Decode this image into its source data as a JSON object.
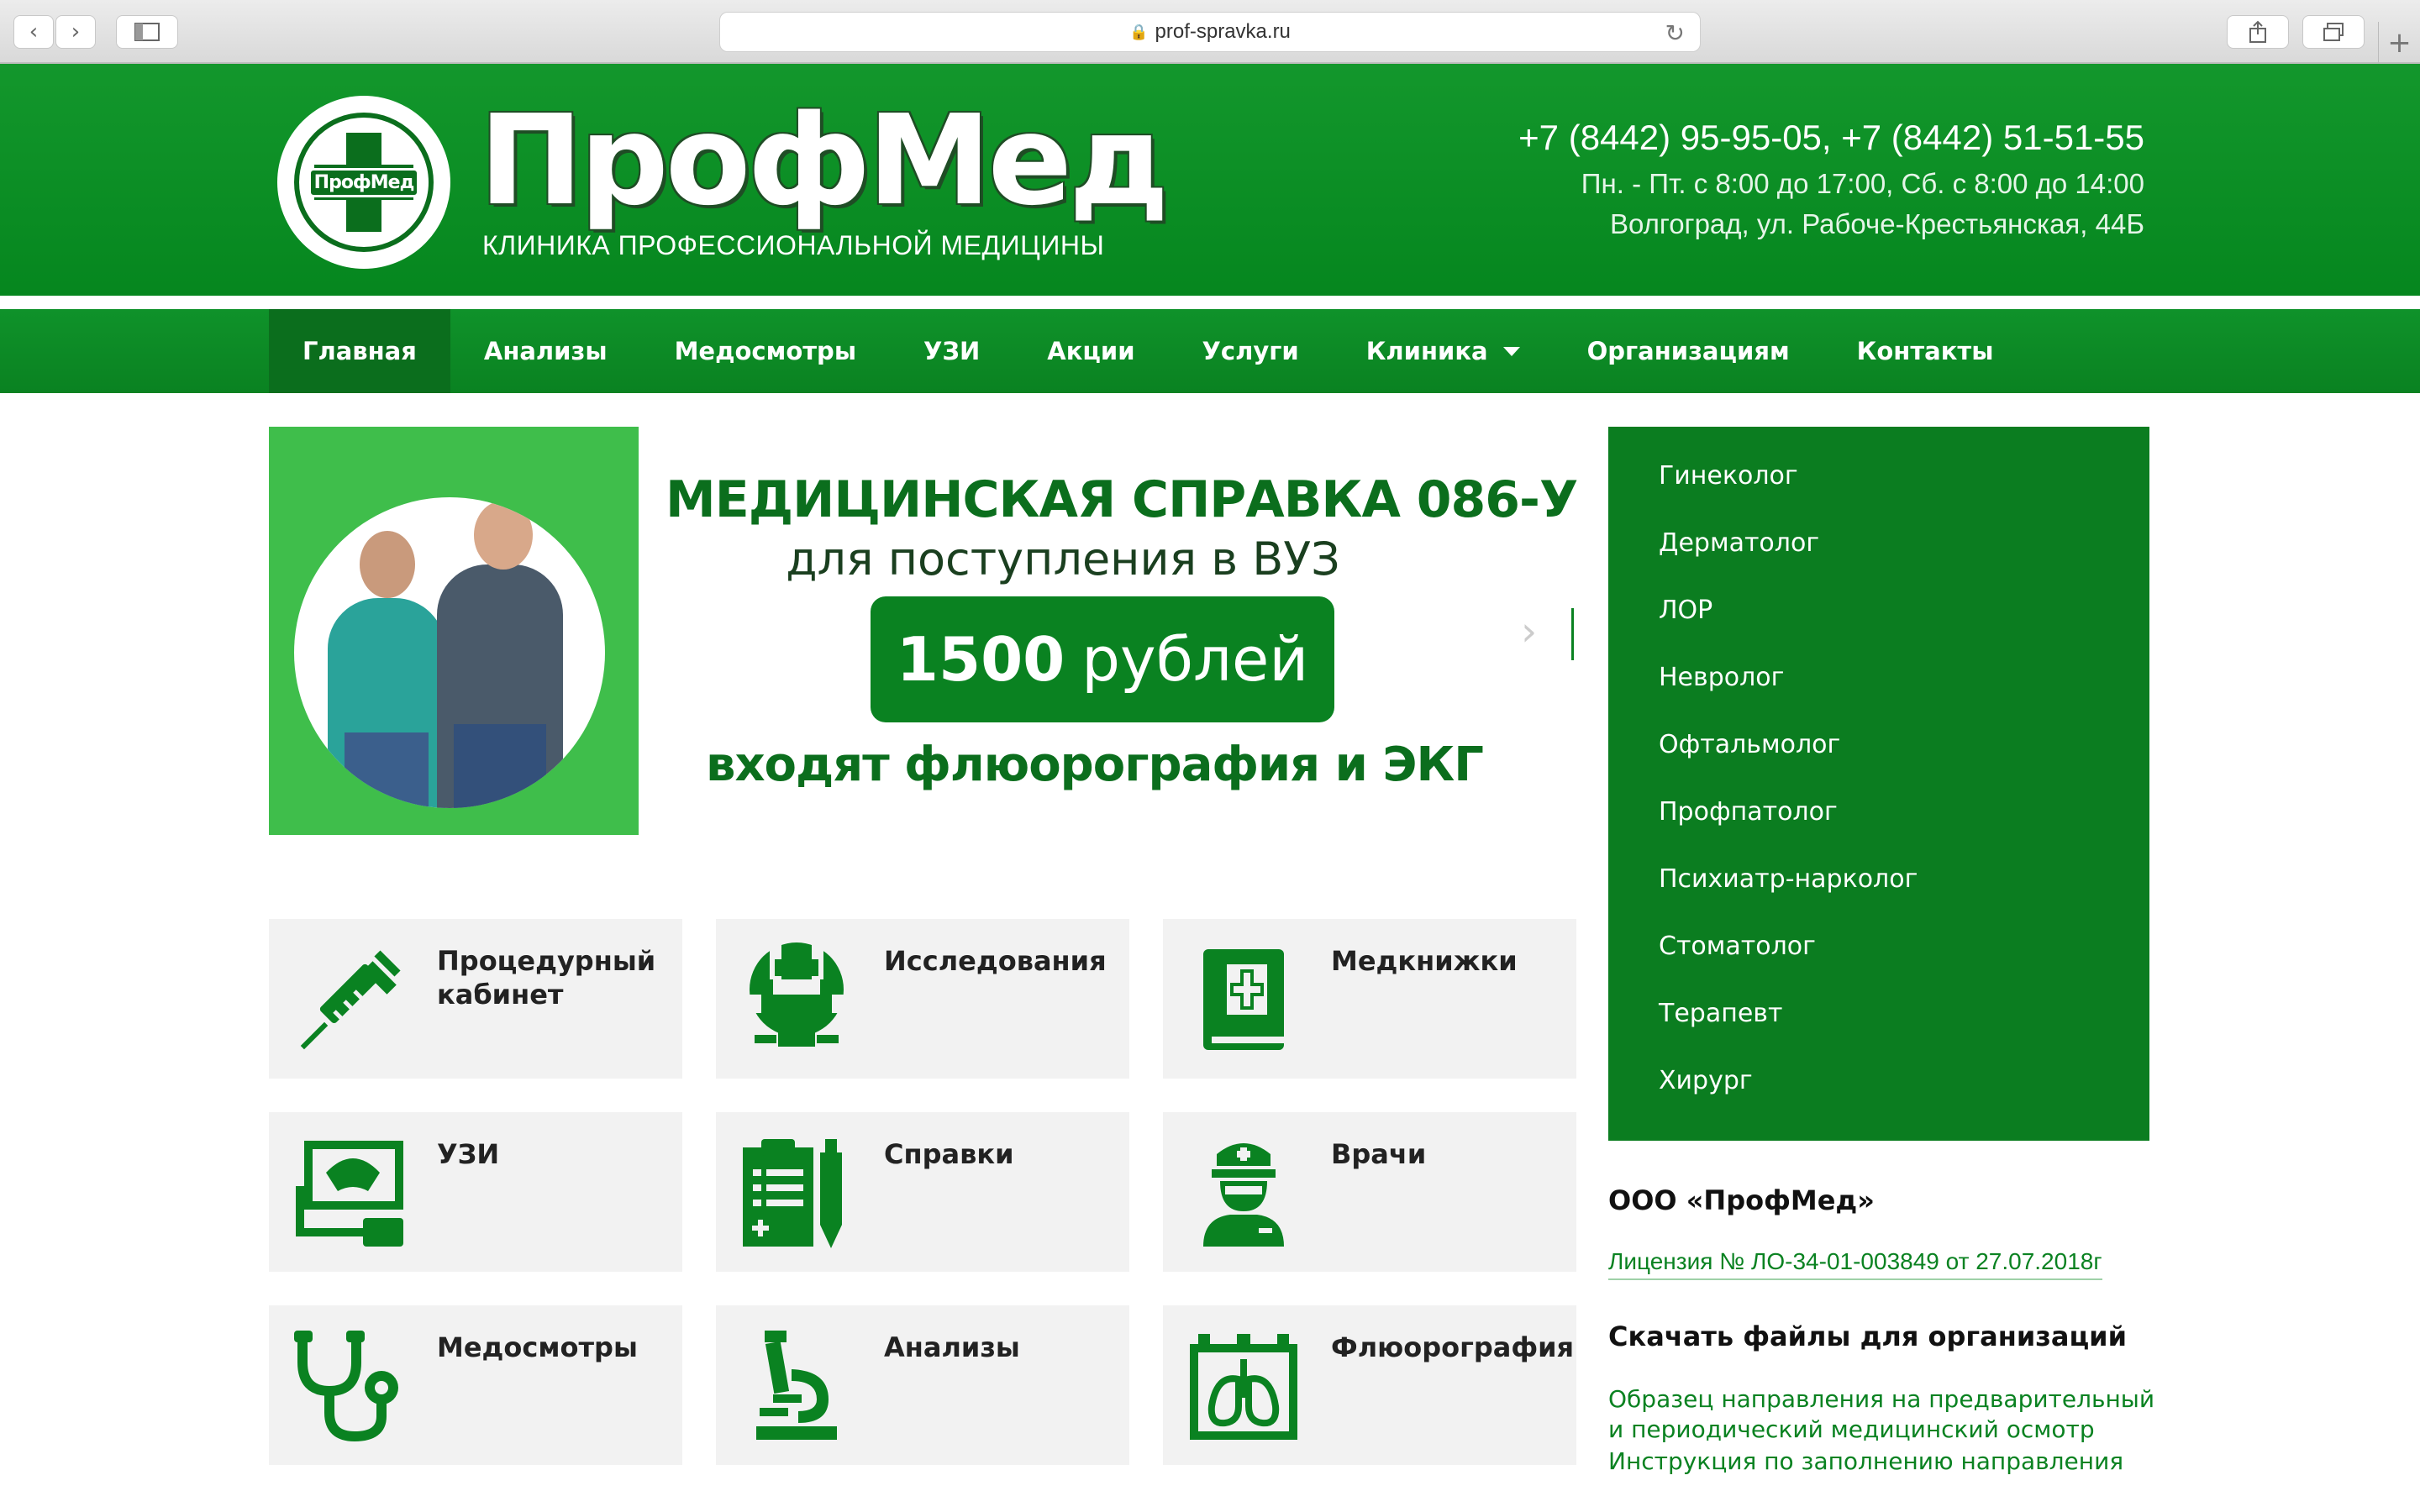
{
  "browser": {
    "url": "prof-spravka.ru"
  },
  "header": {
    "logo_text": "ПрофМед",
    "brand_name": "ПрофМед",
    "brand_subtitle": "КЛИНИКА ПРОФЕССИОНАЛЬНОЙ МЕДИЦИНЫ",
    "phones": "+7 (8442) 95-95-05, +7 (8442) 51-51-55",
    "hours": "Пн. - Пт. с 8:00 до 17:00, Сб. с 8:00 до 14:00",
    "address": "Волгоград, ул. Рабоче-Крестьянская, 44Б"
  },
  "nav": {
    "items": [
      {
        "label": "Главная",
        "active": true
      },
      {
        "label": "Анализы"
      },
      {
        "label": "Медосмотры"
      },
      {
        "label": "УЗИ"
      },
      {
        "label": "Акции"
      },
      {
        "label": "Услуги"
      },
      {
        "label": "Клиника",
        "dropdown": true
      },
      {
        "label": "Организациям"
      },
      {
        "label": "Контакты"
      }
    ]
  },
  "banner": {
    "title": "МЕДИЦИНСКАЯ СПРАВКА 086-У",
    "subtitle": "для поступления в ВУЗ",
    "price_amount": "1500",
    "price_currency": "рублей",
    "note": "входят флюорография и ЭКГ"
  },
  "tiles": [
    {
      "label": "Процедурный кабинет",
      "icon": "syringe-icon"
    },
    {
      "label": "Исследования",
      "icon": "research-icon"
    },
    {
      "label": "Медкнижки",
      "icon": "medbook-icon"
    },
    {
      "label": "УЗИ",
      "icon": "ultrasound-icon"
    },
    {
      "label": "Справки",
      "icon": "certificate-icon"
    },
    {
      "label": "Врачи",
      "icon": "doctor-icon"
    },
    {
      "label": "Медосмотры",
      "icon": "stethoscope-icon"
    },
    {
      "label": "Анализы",
      "icon": "microscope-icon"
    },
    {
      "label": "Флюорография",
      "icon": "xray-lungs-icon"
    }
  ],
  "sidebar": {
    "items": [
      {
        "label": "Гинеколог"
      },
      {
        "label": "Дерматолог"
      },
      {
        "label": "ЛОР"
      },
      {
        "label": "Невролог"
      },
      {
        "label": "Офтальмолог"
      },
      {
        "label": "Профпатолог"
      },
      {
        "label": "Психиатр-нарколог"
      },
      {
        "label": "Стоматолог"
      },
      {
        "label": "Терапевт"
      },
      {
        "label": "Хирург"
      }
    ],
    "org_title": "ООО «ПрофМед»",
    "license": "Лицензия № ЛО-34-01-003849 от 27.07.2018г",
    "downloads_title": "Скачать файлы для организаций",
    "downloads": [
      {
        "label": "Образец направления на предварительный и периодический медицинский осмотр"
      },
      {
        "label": "Инструкция по заполнению направления"
      }
    ]
  },
  "colors": {
    "brand_green": "#0a8221",
    "dark_green": "#0b6e1d",
    "banner_green": "#3fbe4b",
    "tile_bg": "#f2f2f2"
  }
}
